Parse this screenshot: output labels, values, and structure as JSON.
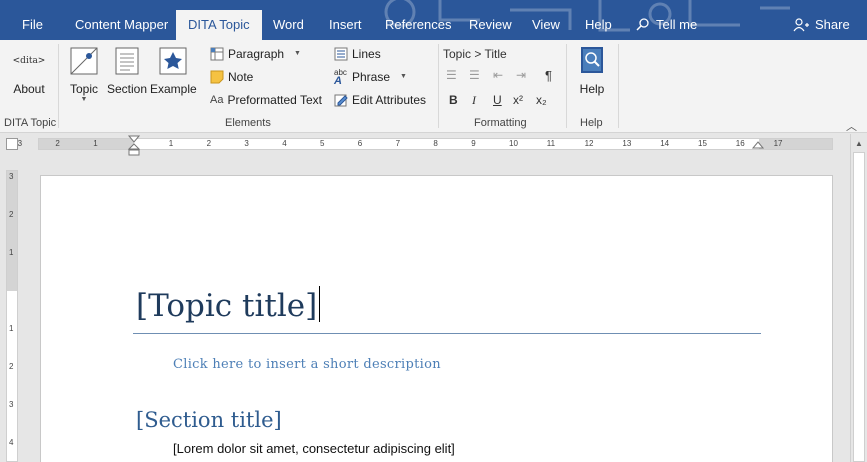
{
  "tabs": [
    {
      "key": "file",
      "label": "File"
    },
    {
      "key": "content_mapper",
      "label": "Content Mapper"
    },
    {
      "key": "dita_topic",
      "label": "DITA Topic"
    },
    {
      "key": "word",
      "label": "Word"
    },
    {
      "key": "insert",
      "label": "Insert"
    },
    {
      "key": "references",
      "label": "References"
    },
    {
      "key": "review",
      "label": "Review"
    },
    {
      "key": "view",
      "label": "View"
    },
    {
      "key": "help",
      "label": "Help"
    }
  ],
  "tell_me": "Tell me",
  "share": "Share",
  "ribbon": {
    "dita_group": {
      "about": "About",
      "logo_text": "<dita>",
      "label": "DITA Topic"
    },
    "elements_group": {
      "topic": "Topic",
      "section": "Section",
      "example": "Example",
      "paragraph": "Paragraph",
      "note": "Note",
      "preformatted": "Preformatted Text",
      "lines": "Lines",
      "phrase": "Phrase",
      "edit_attributes": "Edit Attributes",
      "phrase_icon_text": "abc",
      "preformatted_icon_text": "Aa",
      "label": "Elements"
    },
    "formatting_group": {
      "breadcrumb": "Topic > Title",
      "bold": "B",
      "italic": "I",
      "underline": "U",
      "superscript": "x²",
      "subscript": "x₂",
      "pilcrow": "¶",
      "label": "Formatting"
    },
    "help_group": {
      "help": "Help",
      "label": "Help"
    }
  },
  "ruler": {
    "h_labels": [
      "3",
      "2",
      "1",
      "1",
      "2",
      "3",
      "4",
      "5",
      "6",
      "7",
      "8",
      "9",
      "10",
      "11",
      "12",
      "13",
      "14",
      "15",
      "16",
      "17"
    ],
    "v_labels": [
      "3",
      "2",
      "1",
      "1",
      "2",
      "3",
      "4"
    ]
  },
  "document": {
    "topic_title": "[Topic title]",
    "short_description": "Click here to insert a short description",
    "section_title": "[Section title]",
    "body_text": "[Lorem dolor sit amet, consectetur adipiscing elit]"
  },
  "colors": {
    "accent": "#2b579a",
    "title": "#1f3b5c",
    "link": "#4d7fb6"
  }
}
